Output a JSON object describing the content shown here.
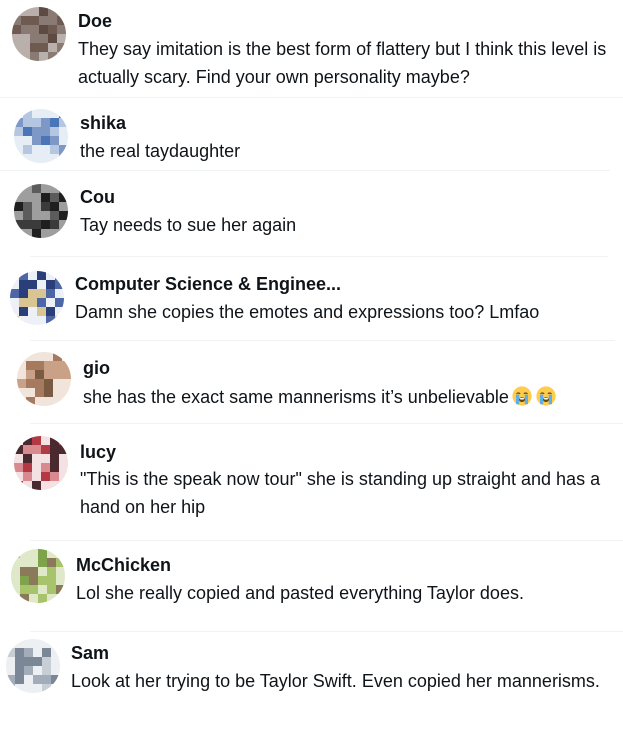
{
  "comments": [
    {
      "name": "Doe",
      "text": "They say imitation is the best form of flattery but I think this level is actually scary. Find your own personality maybe?",
      "avatar_colors": [
        "#5c4a43",
        "#6f5a52",
        "#8a7a74",
        "#b9b0ac"
      ]
    },
    {
      "name": "shika",
      "text": "the real taydaughter",
      "avatar_colors": [
        "#4a76b8",
        "#7d97c7",
        "#b4c6e0",
        "#e6edf5"
      ]
    },
    {
      "name": "Cou",
      "text": "Tay needs to sue her again",
      "avatar_colors": [
        "#1f1f1f",
        "#3b3b3b",
        "#5c5c5c",
        "#9e9e9e"
      ]
    },
    {
      "name": "Computer Science & Enginee...",
      "text": "Damn she copies the emotes and expressions too? Lmfao",
      "avatar_colors": [
        "#2a3f7a",
        "#4d66a6",
        "#d9c592",
        "#eef0f7"
      ]
    },
    {
      "name": "gio",
      "text": "she has the exact same mannerisms it’s unbelievable",
      "emoji_count": 2,
      "avatar_colors": [
        "#7a5a43",
        "#a57a5e",
        "#c9a187",
        "#f1e4da"
      ]
    },
    {
      "name": "lucy",
      "text": "\"This is the speak now tour\" she is standing up straight and has a hand on her hip",
      "avatar_colors": [
        "#4a2a2f",
        "#b33a44",
        "#d88a8f",
        "#f3e1e3"
      ]
    },
    {
      "name": "McChicken",
      "text": "Lol she really copied and pasted everything Taylor does.",
      "avatar_colors": [
        "#7ea34a",
        "#a7c36b",
        "#8b7a5a",
        "#dfe8c9"
      ]
    },
    {
      "name": "Sam",
      "text": "Look at her trying to be Taylor Swift. Even copied her mannerisms.",
      "avatar_colors": [
        "#7b8796",
        "#a3adb9",
        "#c7ced6",
        "#edf0f3"
      ]
    }
  ],
  "emoji_name": "loudly-crying-face"
}
